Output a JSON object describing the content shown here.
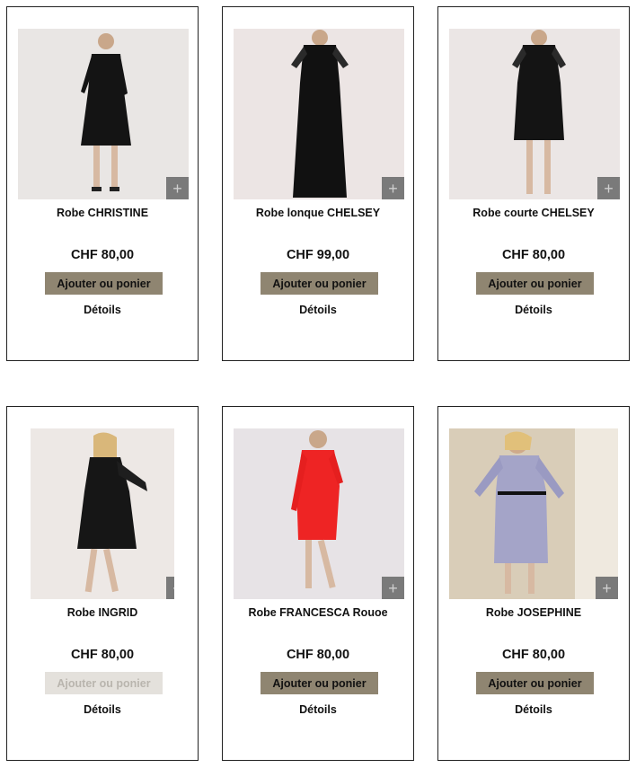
{
  "zoom_label": "+",
  "colors": {
    "button_bg": "#8f8571",
    "button_disabled_bg": "#e4e1dc",
    "card_border": "#222222"
  },
  "products": [
    {
      "name": "Robe CHRISTINE",
      "price": "CHF 80,00",
      "button": "Ajouter ou ponier",
      "details": "Détoils",
      "dress_color": "black",
      "available": true
    },
    {
      "name": "Robe lonque CHELSEY",
      "price": "CHF 99,00",
      "button": "Ajouter ou ponier",
      "details": "Détoils",
      "dress_color": "black",
      "available": true
    },
    {
      "name": "Robe courte CHELSEY",
      "price": "CHF 80,00",
      "button": "Ajouter ou ponier",
      "details": "Détoils",
      "dress_color": "black",
      "available": true
    },
    {
      "name": "Robe INGRID",
      "price": "CHF 80,00",
      "button": "Ajouter ou ponier",
      "details": "Détoils",
      "dress_color": "black lace",
      "available": false
    },
    {
      "name": "Robe FRANCESCA Rouoe",
      "price": "CHF 80,00",
      "button": "Ajouter ou ponier",
      "details": "Détoils",
      "dress_color": "red",
      "available": true
    },
    {
      "name": "Robe JOSEPHINE",
      "price": "CHF 80,00",
      "button": "Ajouter ou ponier",
      "details": "Détoils",
      "dress_color": "lavender",
      "available": true
    }
  ]
}
